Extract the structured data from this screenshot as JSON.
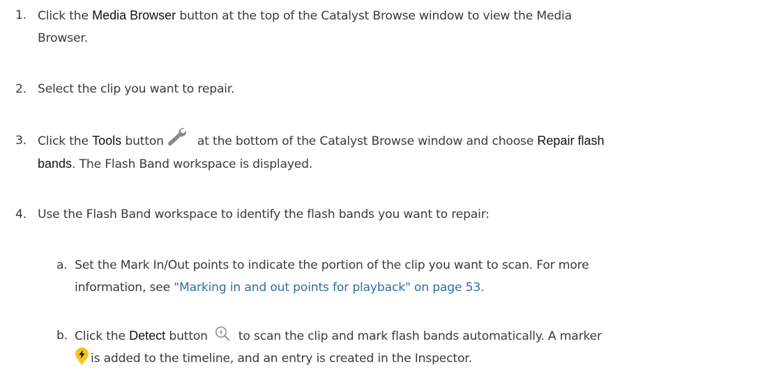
{
  "steps": [
    {
      "number": "1.",
      "line1_pre": "Click the ",
      "line1_bold": "Media Browser",
      "line1_post": " button at the top of the Catalyst Browse window to view the Media",
      "line2": "Browser."
    },
    {
      "number": "2.",
      "text": "Select the clip you want to repair."
    },
    {
      "number": "3.",
      "pre": "Click the ",
      "bold1": "Tools",
      "mid": " button",
      "post": "at the bottom of the Catalyst Browse window and choose ",
      "bold2a": "Repair flash",
      "bold2b": "bands",
      "line2_post": ". The Flash Band workspace is displayed.",
      "icon": "wrench-icon"
    },
    {
      "number": "4.",
      "text": "Use the Flash Band workspace to identify the flash bands you want to repair:"
    }
  ],
  "substeps": [
    {
      "letter": "a.",
      "line1": "Set the Mark In/Out points to indicate the portion of the clip you want to scan. For more",
      "line2_pre": "information, see ",
      "link": "\"Marking in and out points for playback\" on page 53."
    },
    {
      "letter": "b.",
      "pre": "Click the ",
      "bold": "Detect",
      "mid": " button",
      "post": "to scan the clip and mark flash bands automatically. A marker",
      "line2": "is added to the timeline, and an entry is created in the Inspector.",
      "icons": [
        "detect-icon",
        "flash-marker-icon"
      ]
    }
  ],
  "colors": {
    "text": "#3a3a3a",
    "ui_label": "#111111",
    "link": "#2f6ea5",
    "icon_gray": "#8a8a8a",
    "marker_yellow": "#f5c518"
  }
}
